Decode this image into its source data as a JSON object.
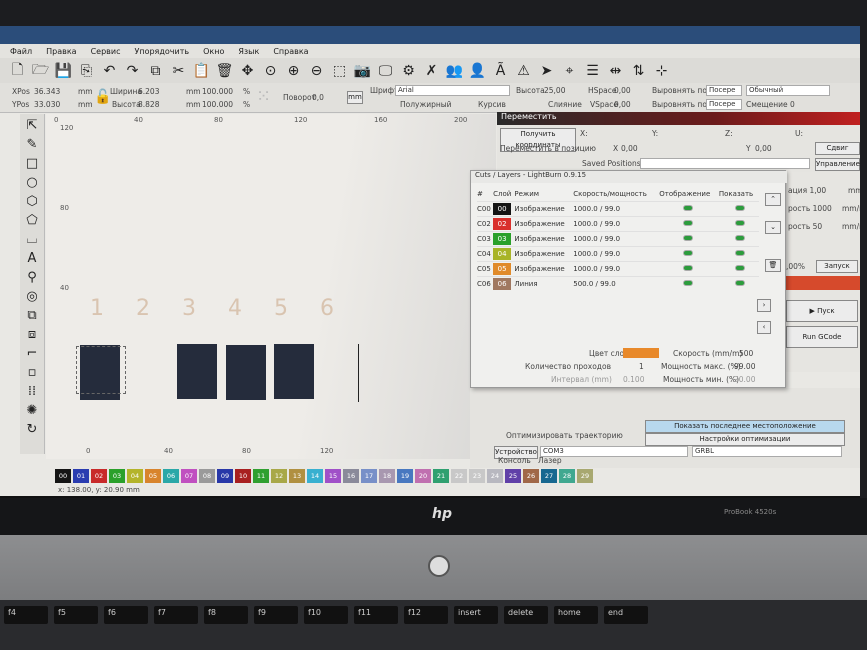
{
  "menu": [
    "Файл",
    "Правка",
    "Сервис",
    "Упорядочить",
    "Окно",
    "Язык",
    "Справка"
  ],
  "toolbar_icons": [
    "new-file",
    "open-folder",
    "save",
    "import",
    "undo",
    "redo",
    "copy",
    "cut",
    "paste",
    "delete",
    "move",
    "zoom-fit",
    "zoom-in",
    "zoom-out",
    "frame-select",
    "camera",
    "monitor",
    "settings-gear",
    "tools",
    "users",
    "user",
    "text-tool",
    "warning",
    "send",
    "target",
    "bars",
    "align",
    "adjust",
    "distribute"
  ],
  "props": {
    "xpos_label": "XPos",
    "xpos": "36.343",
    "ypos_label": "YPos",
    "ypos": "33.030",
    "unit": "mm",
    "width_label": "Ширина",
    "width": "6.203",
    "height_label": "Высота",
    "height": "8.828",
    "scale_x": "100.000",
    "scale_y": "100.000",
    "pct": "%",
    "rotate_label": "Поворот",
    "rotate": "0,0",
    "mm_button": "mm",
    "font_label": "Шрифт",
    "font": "Arial",
    "bold": "Полужирный",
    "italic": "Курсив",
    "text_height_label": "Высота",
    "text_height": "25,00",
    "hspace_label": "HSpace",
    "hspace": "0,00",
    "weld": "Слияние",
    "vspace_label": "VSpace",
    "vspace": "0,00",
    "align_x": "Выровнять по X",
    "align_x_val": "Посере",
    "style_val": "Обычный",
    "align_y": "Выровнять по Y",
    "align_y_val": "Посере",
    "offset": "Смещение 0"
  },
  "tools": [
    "select",
    "pencil",
    "rectangle",
    "ellipse",
    "polygon",
    "pentagon",
    "frame",
    "text",
    "position-marker",
    "circle-tool",
    "weld",
    "union",
    "corner",
    "small-square",
    "grid-array",
    "circular-array",
    "rotate"
  ],
  "canvas": {
    "ruler_top": [
      "0",
      "40",
      "80",
      "120",
      "160",
      "200"
    ],
    "ruler_left": [
      "120",
      "80",
      "40"
    ],
    "bottom_ticks": [
      "0",
      "40",
      "80",
      "120"
    ],
    "numbers": [
      "1",
      "2",
      "3",
      "4",
      "5",
      "6"
    ]
  },
  "move_dialog": {
    "title": "Переместить",
    "get_coords": "Получить координаты",
    "x": "X:",
    "y": "Y:",
    "z": "Z:",
    "u": "U:",
    "move_to": "Переместить в позицию",
    "x_label": "X",
    "x_val": "0,00",
    "y_label": "Y",
    "y_val": "0,00",
    "shift": "Сдвиг",
    "saved": "Saved Positions:",
    "manage": "Управление"
  },
  "layers": {
    "title": "Cuts / Layers - LightBurn 0.9.15",
    "headers": [
      "#",
      "Слой",
      "Режим",
      "Скорость/мощность",
      "Отображение",
      "Показать"
    ],
    "rows": [
      {
        "id": "C00",
        "layer": "00",
        "color": "#141414",
        "mode": "Изображение",
        "speed": "1000.0 / 99.0"
      },
      {
        "id": "C02",
        "layer": "02",
        "color": "#d9302c",
        "mode": "Изображение",
        "speed": "1000.0 / 99.0"
      },
      {
        "id": "C03",
        "layer": "03",
        "color": "#2aa02a",
        "mode": "Изображение",
        "speed": "1000.0 / 99.0"
      },
      {
        "id": "C04",
        "layer": "04",
        "color": "#a8b428",
        "mode": "Изображение",
        "speed": "1000.0 / 99.0"
      },
      {
        "id": "C05",
        "layer": "05",
        "color": "#e08a2a",
        "mode": "Изображение",
        "speed": "1000.0 / 99.0"
      },
      {
        "id": "C06",
        "layer": "06",
        "color": "#a07860",
        "mode": "Линия",
        "speed": "500.0 / 99.0"
      }
    ],
    "color_label": "Цвет слоя",
    "layer_color": "#e8892a",
    "speed_label": "Скорость (mm/m)",
    "speed": "500",
    "passes_label": "Количество проходов",
    "passes": "1",
    "pmax_label": "Мощность макс. (%)",
    "pmax": "99.00",
    "interval_label": "Интервал (mm)",
    "interval": "0.100",
    "pmin_label": "Мощность мин. (%)",
    "pmin": "20.00"
  },
  "right": {
    "r1": "ация 1,00",
    "r1u": "mm",
    "r2": "рость 1000",
    "r2u": "mm/m",
    "r3": "рость 50",
    "r3u": "mm/m",
    "r4": ",00%",
    "start": "Запуск",
    "run": "Пуск",
    "gcode": "Run GCode"
  },
  "laser": {
    "opt": "Оптимизировать траекторию",
    "show_last": "Показать последнее местоположение",
    "opt_settings": "Настройки оптимизации",
    "device": "Устройство",
    "port": "COM3",
    "controller": "GRBL",
    "tab_console": "Консоль",
    "tab_laser": "Лазер"
  },
  "palette": [
    [
      "00",
      "#151515"
    ],
    [
      "01",
      "#2a3cb0"
    ],
    [
      "02",
      "#c82a2a"
    ],
    [
      "03",
      "#2aa02a"
    ],
    [
      "04",
      "#b4b42a"
    ],
    [
      "05",
      "#d8842c"
    ],
    [
      "06",
      "#2aa8a8"
    ],
    [
      "07",
      "#c050c0"
    ],
    [
      "08",
      "#9a9a9a"
    ],
    [
      "09",
      "#2838a8"
    ],
    [
      "10",
      "#a82020"
    ],
    [
      "11",
      "#30a030"
    ],
    [
      "12",
      "#a8a848"
    ],
    [
      "13",
      "#b09040"
    ],
    [
      "14",
      "#38b0d0"
    ],
    [
      "15",
      "#a050c8"
    ],
    [
      "16",
      "#8a8a9a"
    ],
    [
      "17",
      "#7890c8"
    ],
    [
      "18",
      "#a898b0"
    ],
    [
      "19",
      "#4878c0"
    ],
    [
      "20",
      "#c070b0"
    ],
    [
      "21",
      "#30a070"
    ],
    [
      "22",
      "#c8c8c8"
    ],
    [
      "23",
      "#c8c8c8"
    ],
    [
      "24",
      "#b8b8c0"
    ],
    [
      "25",
      "#6040a8"
    ],
    [
      "26",
      "#a06848"
    ],
    [
      "27",
      "#186890"
    ],
    [
      "28",
      "#40a890"
    ],
    [
      "29",
      "#a8a870"
    ]
  ],
  "status": "x: 138.00, y: 20.90 mm",
  "laptop": {
    "model": "ProBook 4520s",
    "keys": [
      "f4",
      "f5",
      "f6",
      "f7",
      "f8",
      "f9",
      "f10",
      "f11",
      "f12",
      "insert",
      "delete",
      "home",
      "end"
    ]
  }
}
